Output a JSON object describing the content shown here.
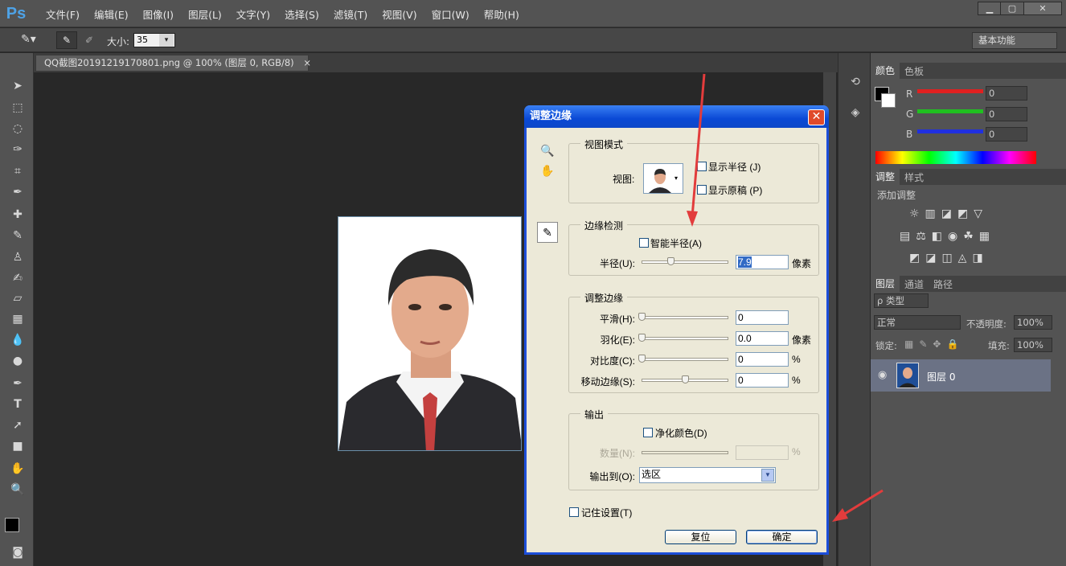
{
  "app": {
    "logo": "Ps"
  },
  "menu": [
    "文件(F)",
    "编辑(E)",
    "图像(I)",
    "图层(L)",
    "文字(Y)",
    "选择(S)",
    "滤镜(T)",
    "视图(V)",
    "窗口(W)",
    "帮助(H)"
  ],
  "window_controls": {
    "minimize": "▁",
    "maximize": "▢",
    "close": "✕"
  },
  "options": {
    "size_label": "大小:",
    "size_value": "35",
    "workspace": "基本功能"
  },
  "document": {
    "tab_title": "QQ截图20191219170801.png @ 100% (图层 0, RGB/8)",
    "close": "×"
  },
  "color_panel": {
    "tabs": [
      "颜色",
      "色板"
    ],
    "channels": [
      {
        "label": "R",
        "value": "0",
        "color": "#e02020"
      },
      {
        "label": "G",
        "value": "0",
        "color": "#20c020"
      },
      {
        "label": "B",
        "value": "0",
        "color": "#2030e0"
      }
    ]
  },
  "adjust_panel": {
    "tabs": [
      "调整",
      "样式"
    ],
    "add_label": "添加调整"
  },
  "layers_panel": {
    "tabs": [
      "图层",
      "通道",
      "路径"
    ],
    "filter": "ρ 类型",
    "blend_mode": "正常",
    "opacity_label": "不透明度:",
    "opacity_value": "100%",
    "lock_label": "锁定:",
    "fill_label": "填充:",
    "fill_value": "100%",
    "layer_name": "图层 0"
  },
  "dialog": {
    "title": "调整边缘",
    "close": "✕",
    "view_mode": {
      "title": "视图模式",
      "view_label": "视图:",
      "show_radius": "显示半径 (J)",
      "show_original": "显示原稿 (P)"
    },
    "edge_detection": {
      "title": "边缘检测",
      "smart_radius": "智能半径(A)",
      "radius_label": "半径(U):",
      "radius_value": "7.9",
      "radius_unit": "像素",
      "radius_level": 0.33
    },
    "adjust_edge": {
      "title": "调整边缘",
      "rows": [
        {
          "label": "平滑(H):",
          "value": "0",
          "unit": "",
          "level": 0.0
        },
        {
          "label": "羽化(E):",
          "value": "0.0",
          "unit": "像素",
          "level": 0.0
        },
        {
          "label": "对比度(C):",
          "value": "0",
          "unit": "%",
          "level": 0.0
        },
        {
          "label": "移动边缘(S):",
          "value": "0",
          "unit": "%",
          "level": 0.5
        }
      ]
    },
    "output": {
      "title": "输出",
      "decontaminate": "净化颜色(D)",
      "amount_label": "数量(N):",
      "amount_unit": "%",
      "output_to_label": "输出到(O):",
      "output_to_value": "选区"
    },
    "remember": "记住设置(T)",
    "reset_button": "复位",
    "ok_button": "确定"
  },
  "colors": {
    "accent_red": "#e23c3c",
    "xp_blue": "#0a49d5"
  }
}
